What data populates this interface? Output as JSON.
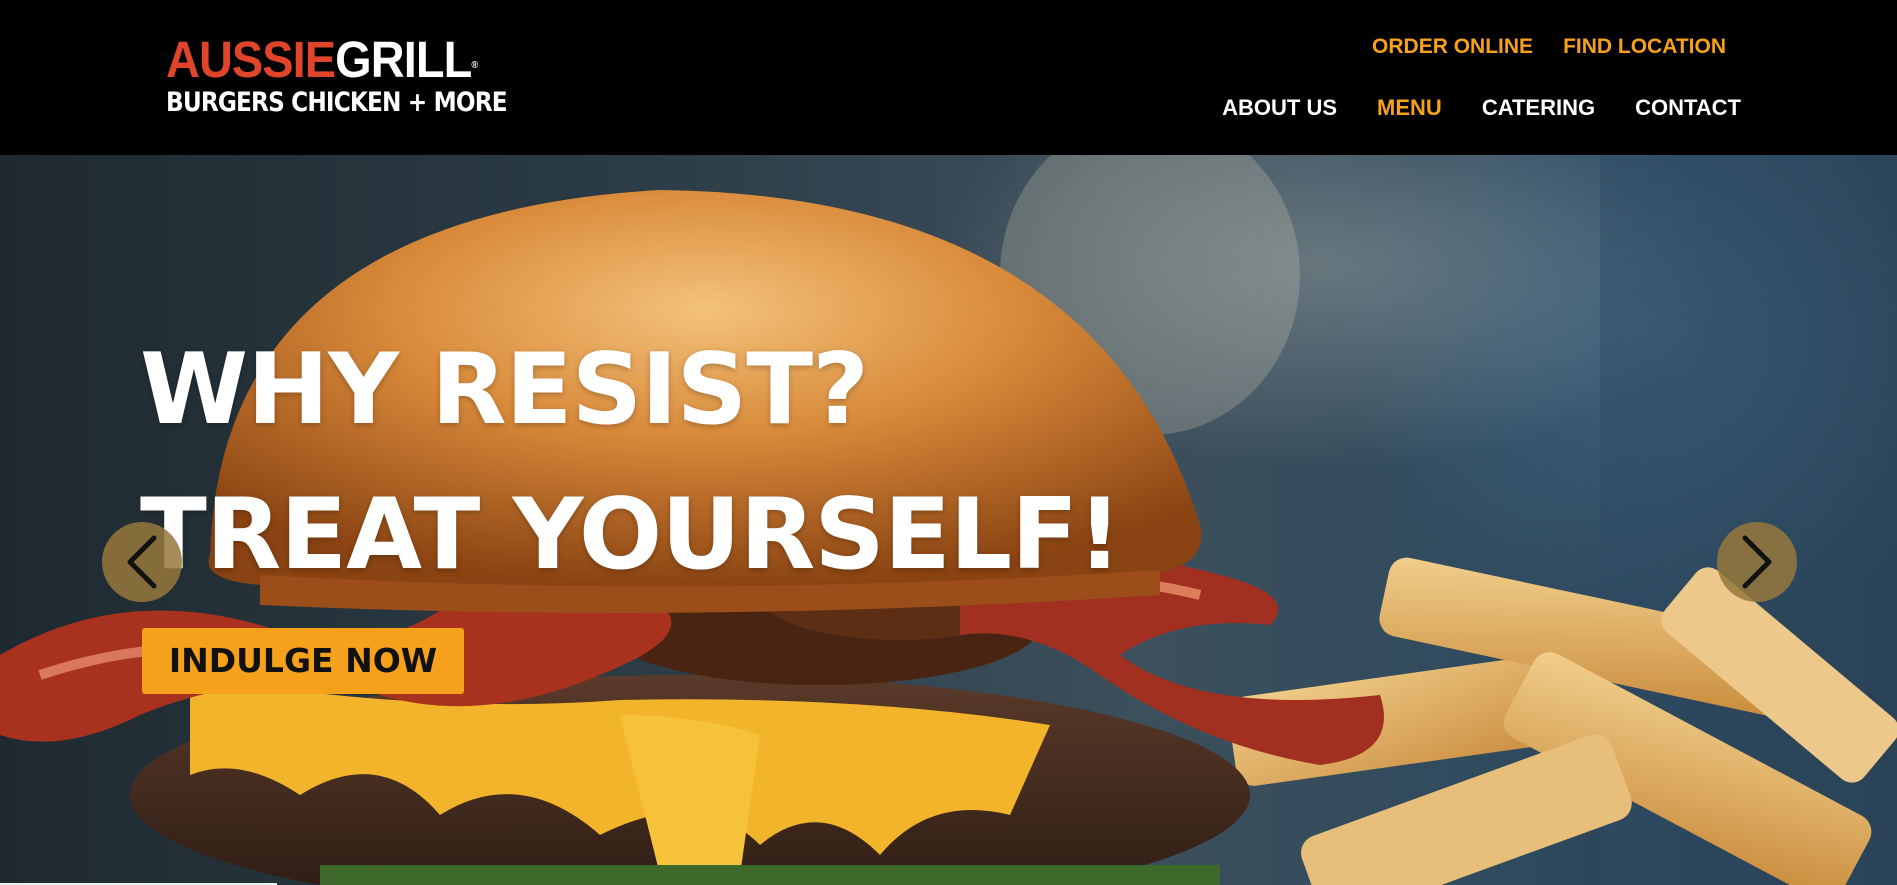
{
  "brand": {
    "logo_word1": "AUSSIE",
    "logo_word2": "GRILL",
    "registered_mark": "®",
    "tagline": "BURGERS CHICKEN + MORE",
    "colors": {
      "logo_red": "#e0442a",
      "accent_orange": "#f6a11b",
      "header_bg": "#000000"
    }
  },
  "top_nav": {
    "order_online": "ORDER ONLINE",
    "find_location": "FIND LOCATION"
  },
  "main_nav": {
    "items": [
      {
        "label": "ABOUT US",
        "active": false
      },
      {
        "label": "MENU",
        "active": true
      },
      {
        "label": "CATERING",
        "active": false
      },
      {
        "label": "CONTACT",
        "active": false
      }
    ]
  },
  "hero": {
    "headline_line1": "WHY RESIST?",
    "headline_line2": "TREAT YOURSELF!",
    "cta_label": "INDULGE NOW",
    "prev_icon": "chevron-left-icon",
    "next_icon": "chevron-right-icon",
    "background_image": "burger-with-bacon-cheese-and-fries-photo"
  }
}
